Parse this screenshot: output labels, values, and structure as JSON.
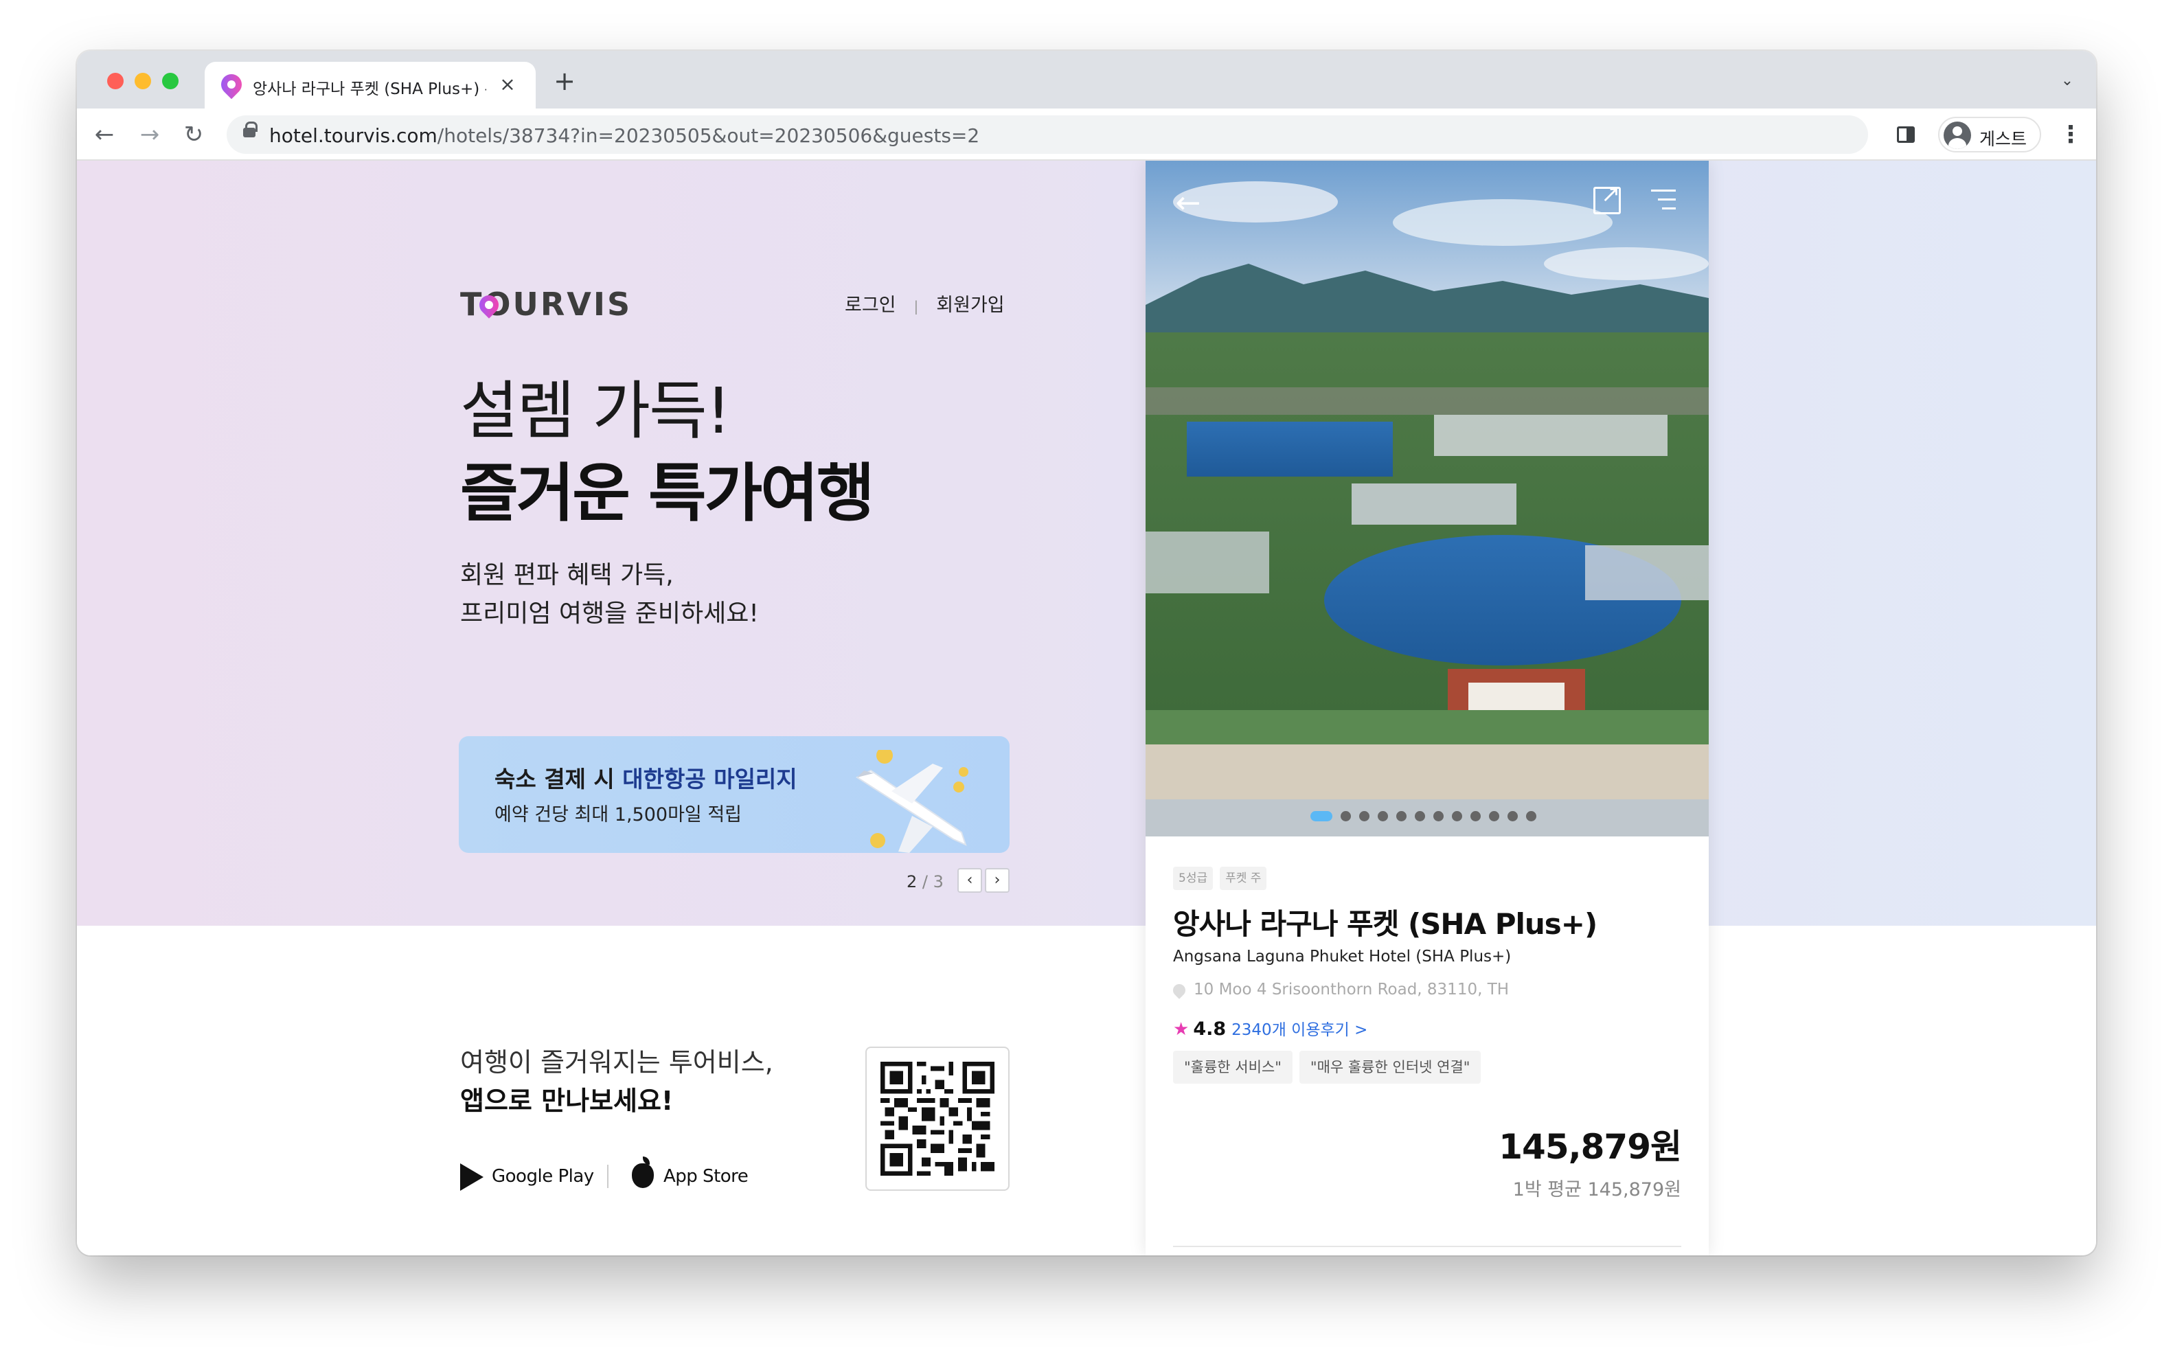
{
  "browser": {
    "tab_title": "앙사나 라구나 푸켓 (SHA Plus+) -",
    "url_host": "hotel.tourvis.com",
    "url_path": "/hotels/38734?in=20230505&out=20230506&guests=2",
    "profile_name": "게스트"
  },
  "header": {
    "logo": "TOURVIS",
    "login": "로그인",
    "signup": "회원가입",
    "separator": "|"
  },
  "hero": {
    "title_line1": "설렘 가득!",
    "title_line2": "즐거운 특가여행",
    "subtitle_line1": "회원 편파 혜택 가득,",
    "subtitle_line2": "프리미엄 여행을 준비하세요!"
  },
  "promo": {
    "title_prefix": "숙소 결제 시 ",
    "title_highlight": "대한항공 마일리지",
    "description": "예약 건당 최대 1,500마일 적립",
    "pager_current": "2",
    "pager_total": "/ 3"
  },
  "app_download": {
    "line1": "여행이 즐거워지는 투어비스,",
    "line2": "앱으로 만나보세요!",
    "google_play": "Google Play",
    "app_store": "App Store"
  },
  "hotel_card": {
    "grade_chip": "5성급",
    "location_chip": "푸켓 주",
    "name": "앙사나 라구나 푸켓 (SHA Plus+)",
    "name_en": "Angsana Laguna Phuket Hotel (SHA Plus+)",
    "address": "10 Moo 4 Srisoonthorn Road, 83110, TH",
    "rating": "4.8",
    "review_link": "2340개 이용후기 >",
    "tags": [
      "\"훌륭한 서비스\"",
      "\"매우 훌륭한 인터넷 연결\""
    ],
    "price": "145,879원",
    "price_note": "1박 평균 145,879원",
    "photo_count": 12,
    "photo_active_index": 1
  },
  "colors": {
    "accent_blue": "#2f6fe0",
    "star_pink": "#e73cb2",
    "promo_highlight": "#1d3b8f",
    "carousel_active": "#5bb8f5"
  }
}
